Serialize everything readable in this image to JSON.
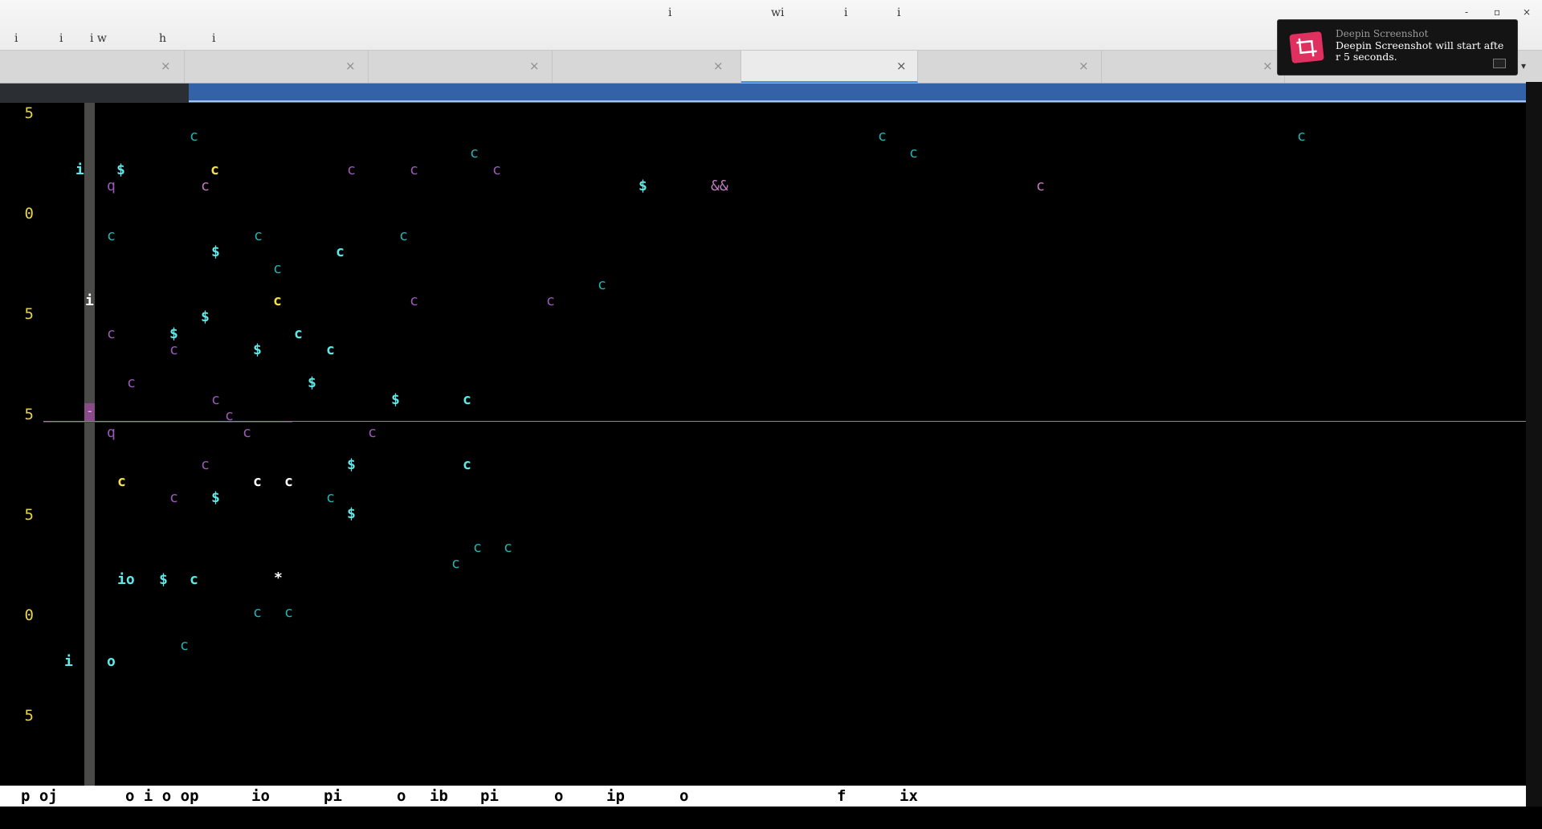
{
  "window": {
    "title_fragments": [
      "i",
      "wi",
      "i",
      "i"
    ],
    "controls": {
      "minimize": "-",
      "maximize": "▫",
      "close": "×"
    }
  },
  "menubar": {
    "items": [
      "i",
      "i",
      "i w",
      "h",
      "i"
    ]
  },
  "tabs": [
    {
      "label": "",
      "close": "×",
      "active": false
    },
    {
      "label": "",
      "close": "×",
      "active": false
    },
    {
      "label": "",
      "close": "×",
      "active": false
    },
    {
      "label": "",
      "close": "×",
      "active": false
    },
    {
      "label": "",
      "close": "×",
      "active": true
    },
    {
      "label": "",
      "close": "×",
      "active": false
    },
    {
      "label": "",
      "close": "×",
      "active": false
    }
  ],
  "tab_dropdown": "▾",
  "editor": {
    "line_numbers": [
      "5",
      "0",
      "5",
      "5",
      "5",
      "0",
      "5"
    ],
    "cursor_char": "-",
    "colors": {
      "cyan": "#20b2b2",
      "bright_cyan": "#5fe8e8",
      "yellow": "#f5e04a",
      "purple": "#9b59b6",
      "pink": "#c07ac0",
      "white": "#ffffff",
      "line_number": "#e6d34a"
    },
    "glyphs": [
      {
        "t": "c",
        "c": "cyan"
      },
      {
        "t": "c",
        "c": "cyan"
      },
      {
        "t": "c",
        "c": "cyan"
      },
      {
        "t": "c",
        "c": "cyan"
      },
      {
        "t": "c",
        "c": "cyan"
      },
      {
        "t": "i",
        "c": "bright_cyan"
      },
      {
        "t": "$",
        "c": "bright_cyan"
      },
      {
        "t": "c",
        "c": "yellow"
      },
      {
        "t": "c",
        "c": "purple"
      },
      {
        "t": "c",
        "c": "purple"
      },
      {
        "t": "c",
        "c": "purple"
      },
      {
        "t": "q",
        "c": "purple"
      },
      {
        "t": "c",
        "c": "pink"
      },
      {
        "t": "$",
        "c": "bright_cyan"
      },
      {
        "t": "&&",
        "c": "pink"
      },
      {
        "t": "c",
        "c": "pink"
      },
      {
        "t": "c",
        "c": "cyan"
      },
      {
        "t": "c",
        "c": "cyan"
      },
      {
        "t": "c",
        "c": "cyan"
      },
      {
        "t": "$",
        "c": "bright_cyan"
      },
      {
        "t": "c",
        "c": "bright_cyan"
      },
      {
        "t": "c",
        "c": "cyan"
      },
      {
        "t": "c",
        "c": "cyan"
      },
      {
        "t": "i",
        "c": "white"
      },
      {
        "t": "c",
        "c": "yellow"
      },
      {
        "t": "c",
        "c": "purple"
      },
      {
        "t": "c",
        "c": "purple"
      },
      {
        "t": "$",
        "c": "bright_cyan"
      },
      {
        "t": "c",
        "c": "purple"
      },
      {
        "t": "$",
        "c": "bright_cyan"
      },
      {
        "t": "c",
        "c": "bright_cyan"
      },
      {
        "t": "c",
        "c": "purple"
      },
      {
        "t": "$",
        "c": "bright_cyan"
      },
      {
        "t": "c",
        "c": "bright_cyan"
      },
      {
        "t": "c",
        "c": "purple"
      },
      {
        "t": "$",
        "c": "bright_cyan"
      },
      {
        "t": "c",
        "c": "purple"
      },
      {
        "t": "$",
        "c": "bright_cyan"
      },
      {
        "t": "c",
        "c": "bright_cyan"
      },
      {
        "t": "c",
        "c": "purple"
      },
      {
        "t": "q",
        "c": "purple"
      },
      {
        "t": "c",
        "c": "purple"
      },
      {
        "t": "c",
        "c": "purple"
      },
      {
        "t": "c",
        "c": "purple"
      },
      {
        "t": "$",
        "c": "bright_cyan"
      },
      {
        "t": "c",
        "c": "bright_cyan"
      },
      {
        "t": "c",
        "c": "yellow"
      },
      {
        "t": "c",
        "c": "white"
      },
      {
        "t": "c",
        "c": "white"
      },
      {
        "t": "c",
        "c": "purple"
      },
      {
        "t": "$",
        "c": "bright_cyan"
      },
      {
        "t": "c",
        "c": "cyan"
      },
      {
        "t": "$",
        "c": "bright_cyan"
      },
      {
        "t": "c",
        "c": "cyan"
      },
      {
        "t": "c",
        "c": "cyan"
      },
      {
        "t": "c",
        "c": "cyan"
      },
      {
        "t": "io",
        "c": "bright_cyan"
      },
      {
        "t": "$",
        "c": "bright_cyan"
      },
      {
        "t": "c",
        "c": "bright_cyan"
      },
      {
        "t": "*",
        "c": "white"
      },
      {
        "t": "c",
        "c": "cyan"
      },
      {
        "t": "c",
        "c": "cyan"
      },
      {
        "t": "c",
        "c": "cyan"
      },
      {
        "t": "i",
        "c": "bright_cyan"
      },
      {
        "t": "o",
        "c": "bright_cyan"
      }
    ]
  },
  "statusbar": {
    "items": [
      "p oj",
      "o i o op",
      "io",
      "pi",
      "o",
      "ib",
      "pi",
      "o",
      "ip",
      "o",
      "f",
      "ix"
    ]
  },
  "toast": {
    "title": "Deepin Screenshot",
    "body": "Deepin Screenshot will start afte r 5 seconds.",
    "icon": "screenshot-crop-icon",
    "accent": "#e03060"
  }
}
